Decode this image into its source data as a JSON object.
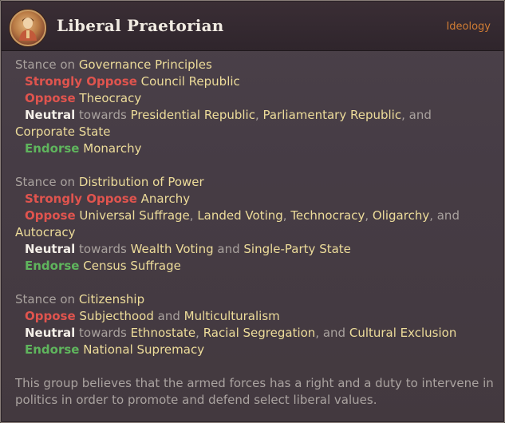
{
  "header": {
    "title": "Liberal Praetorian",
    "tag": "Ideology",
    "emblem_icon": "soldier-portrait-icon"
  },
  "sections": {
    "governance": {
      "stance_prefix": "Stance on",
      "topic": "Governance Principles",
      "strongly_oppose_label": "Strongly Oppose",
      "strongly_oppose_items": [
        "Council Republic"
      ],
      "oppose_label": "Oppose",
      "oppose_items": [
        "Theocracy"
      ],
      "neutral_label": "Neutral",
      "towards": "towards",
      "neutral_items": [
        "Presidential Republic",
        "Parliamentary Republic",
        "Corporate State"
      ],
      "endorse_label": "Endorse",
      "endorse_items": [
        "Monarchy"
      ]
    },
    "power": {
      "stance_prefix": "Stance on",
      "topic": "Distribution of Power",
      "strongly_oppose_label": "Strongly Oppose",
      "strongly_oppose_items": [
        "Anarchy"
      ],
      "oppose_label": "Oppose",
      "oppose_items": [
        "Universal Suffrage",
        "Landed Voting",
        "Technocracy",
        "Oligarchy",
        "Autocracy"
      ],
      "neutral_label": "Neutral",
      "towards": "towards",
      "neutral_items": [
        "Wealth Voting",
        "Single-Party State"
      ],
      "endorse_label": "Endorse",
      "endorse_items": [
        "Census Suffrage"
      ]
    },
    "citizenship": {
      "stance_prefix": "Stance on",
      "topic": "Citizenship",
      "oppose_label": "Oppose",
      "oppose_items": [
        "Subjecthood",
        "Multiculturalism"
      ],
      "neutral_label": "Neutral",
      "towards": "towards",
      "neutral_items": [
        "Ethnostate",
        "Racial Segregation",
        "Cultural Exclusion"
      ],
      "endorse_label": "Endorse",
      "endorse_items": [
        "National Supremacy"
      ]
    }
  },
  "connectors": {
    "comma": ", ",
    "and": " and ",
    "comma_and": ", and "
  },
  "description": "This group believes that the armed forces has a right and a duty to intervene in politics in order to promote and defend select liberal values.",
  "colors": {
    "oppose": "#e0544e",
    "endorse": "#5fb55d",
    "highlight": "#eddc9a",
    "tag": "#d07c34"
  }
}
